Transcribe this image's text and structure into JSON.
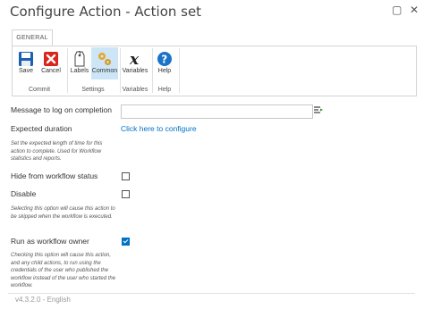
{
  "window": {
    "title": "Configure Action - Action set",
    "minimize_glyph": "▢",
    "close_glyph": "✕"
  },
  "ribbon": {
    "tab": "GENERAL",
    "buttons": {
      "save": "Save",
      "cancel": "Cancel",
      "labels": "Labels",
      "common": "Common",
      "variables": "Variables",
      "help": "Help"
    },
    "groups": {
      "commit": "Commit",
      "settings": "Settings",
      "variables": "Variables",
      "help": "Help"
    },
    "colors": {
      "save_blue": "#1f5fb0",
      "cancel_red": "#d9261c",
      "help_blue": "#1a73c9",
      "active_bg": "#cde6f7"
    }
  },
  "form": {
    "message_label": "Message to log on completion",
    "message_value": "",
    "expected_label": "Expected duration",
    "expected_help": "Set the expected length of time for this action to complete. Used for Workflow statistics and reports.",
    "configure_link": "Click here to configure",
    "hide_label": "Hide from workflow status",
    "hide_checked": false,
    "disable_label": "Disable",
    "disable_checked": false,
    "disable_help": "Selecting this option will cause this action to be skipped when the workflow is executed.",
    "run_owner_label": "Run as workflow owner",
    "run_owner_checked": true,
    "run_owner_help": "Checking this option will cause this action, and any child actions, to run using the credentials of the user who published the workflow instead of the user who started the workflow."
  },
  "footer": {
    "version": "v4.3.2.0 - English"
  }
}
